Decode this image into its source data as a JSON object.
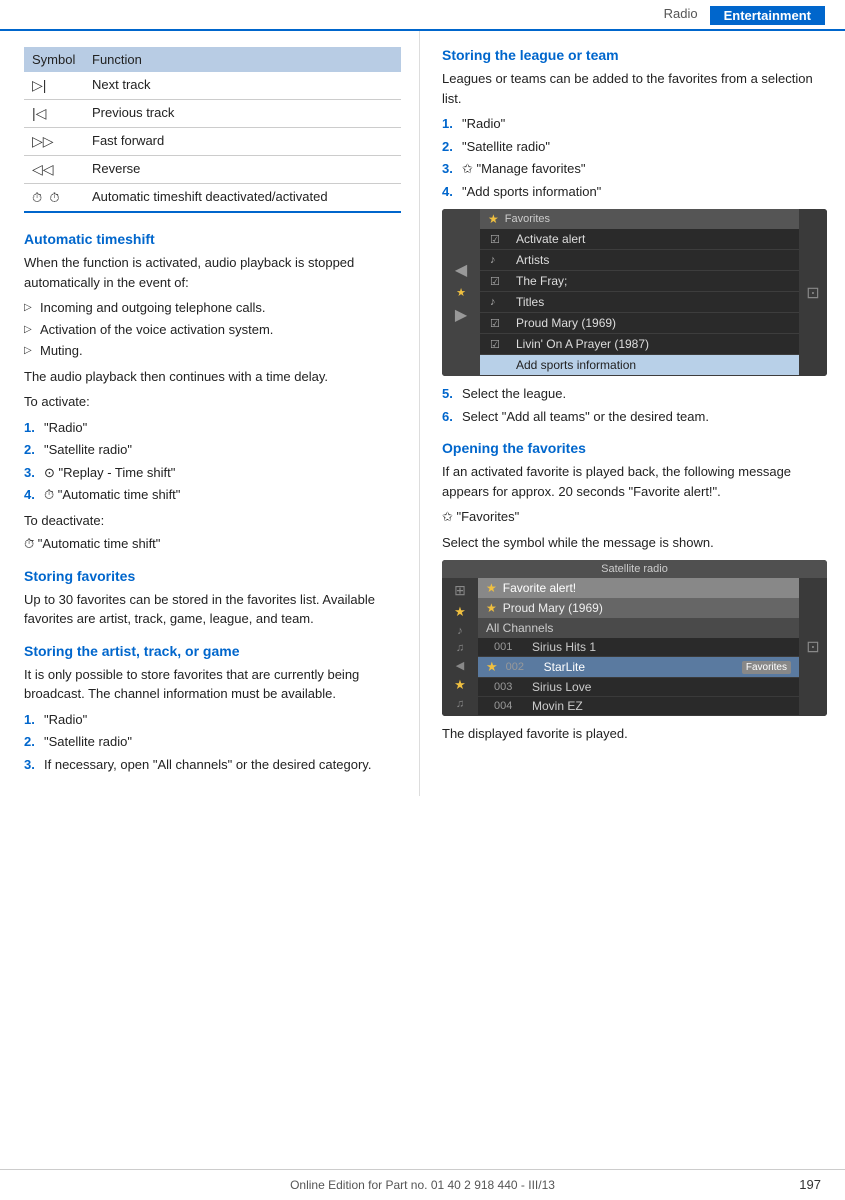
{
  "header": {
    "radio_label": "Radio",
    "entertainment_label": "Entertainment"
  },
  "left": {
    "table": {
      "col1": "Symbol",
      "col2": "Function",
      "rows": [
        {
          "symbol": "▷|",
          "function": "Next track"
        },
        {
          "symbol": "|◁",
          "function": "Previous track"
        },
        {
          "symbol": "▷▷",
          "function": "Fast forward"
        },
        {
          "symbol": "◁◁",
          "function": "Reverse"
        },
        {
          "symbol": "⏱  ⏱̃",
          "function": "Automatic timeshift deactivated/activated"
        }
      ]
    },
    "auto_timeshift": {
      "heading": "Automatic timeshift",
      "intro": "When the function is activated, audio playback is stopped automatically in the event of:",
      "bullets": [
        "Incoming and outgoing telephone calls.",
        "Activation of the voice activation system.",
        "Muting."
      ],
      "after_bullets": "The audio playback then continues with a time delay.",
      "to_activate": "To activate:",
      "activate_steps": [
        "\"Radio\"",
        "\"Satellite radio\"",
        "⊙ \"Replay - Time shift\"",
        "⏱ \"Automatic time shift\""
      ],
      "to_deactivate": "To deactivate:",
      "deactivate_step": "⏱̃ \"Automatic time shift\""
    },
    "storing_favorites": {
      "heading": "Storing favorites",
      "body": "Up to 30 favorites can be stored in the favorites list. Available favorites are artist, track, game, league, and team."
    },
    "storing_artist": {
      "heading": "Storing the artist, track, or game",
      "body": "It is only possible to store favorites that are currently being broadcast. The channel information must be available.",
      "steps": [
        "\"Radio\"",
        "\"Satellite radio\"",
        "If necessary, open \"All channels\" or the desired category."
      ]
    }
  },
  "right": {
    "storing_league": {
      "heading": "Storing the league or team",
      "intro": "Leagues or teams can be added to the favorites from a selection list.",
      "steps": [
        "\"Radio\"",
        "\"Satellite radio\"",
        "✩ \"Manage favorites\"",
        "\"Add sports information\""
      ],
      "screen1": {
        "header": "Favorites",
        "rows": [
          {
            "icon": "☑",
            "text": "Activate alert",
            "highlighted": false
          },
          {
            "icon": "♪",
            "text": "Artists",
            "highlighted": false
          },
          {
            "icon": "☑",
            "text": "The Fray;",
            "highlighted": false
          },
          {
            "icon": "♪",
            "text": "Titles",
            "highlighted": false
          },
          {
            "icon": "☑",
            "text": "Proud Mary (1969)",
            "highlighted": false
          },
          {
            "icon": "☑",
            "text": "Livin' On A Prayer (1987)",
            "highlighted": false
          },
          {
            "text": "Add sports information",
            "highlighted": true
          }
        ]
      },
      "step5": "Select the league.",
      "step6": "Select \"Add all teams\" or the desired team."
    },
    "opening_favorites": {
      "heading": "Opening the favorites",
      "body1": "If an activated favorite is played back, the following message appears for approx. 20 seconds \"Favorite alert!\".",
      "star_line": "✩ \"Favorites\"",
      "body2": "Select the symbol while the message is shown.",
      "screen2": {
        "header": "Satellite radio",
        "alert_row": "★ Favorite alert!",
        "sub_row": "★ Proud Mary (1969)",
        "channels_header": "All Channels",
        "channels": [
          {
            "num": "001",
            "name": "Sirius Hits 1",
            "active": false
          },
          {
            "num": "002",
            "name": "StarLite",
            "active": false
          },
          {
            "num": "003",
            "name": "Sirius Love",
            "active": false
          },
          {
            "num": "004",
            "name": "Movin EZ",
            "active": false
          }
        ],
        "fav_label": "Favorites"
      },
      "after": "The displayed favorite is played."
    }
  },
  "footer": {
    "text": "Online Edition for Part no. 01 40 2 918 440 - III/13",
    "page": "197"
  }
}
